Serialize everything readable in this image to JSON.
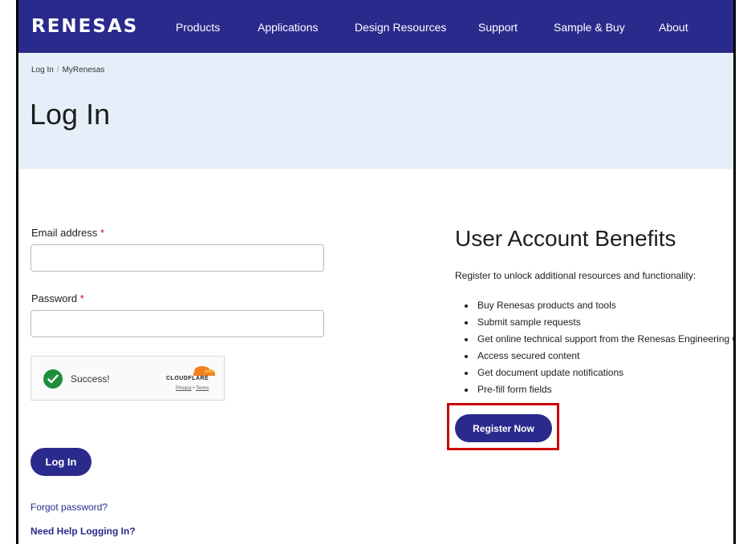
{
  "header": {
    "logo_text": "RENESAS",
    "nav": [
      "Products",
      "Applications",
      "Design Resources",
      "Support",
      "Sample & Buy",
      "About"
    ],
    "background": "#2a2a8c"
  },
  "breadcrumb": {
    "items": [
      "Log In",
      "MyRenesas"
    ],
    "separator": "/"
  },
  "page": {
    "title": "Log In",
    "hero_background": "#e6eff9"
  },
  "form": {
    "email_label": "Email address",
    "password_label": "Password",
    "required_marker": "*",
    "email_value": "",
    "password_value": "",
    "login_button": "Log In",
    "forgot_password": "Forgot password?",
    "need_help": "Need Help Logging In?"
  },
  "captcha": {
    "status_text": "Success!",
    "provider": "CLOUDFLARE",
    "privacy": "Privacy",
    "terms": "Terms",
    "status_icon": "check-circle-icon",
    "status_color": "#1e8e3e"
  },
  "benefits": {
    "title": "User Account Benefits",
    "subtitle": "Register to unlock additional resources and functionality:",
    "items": [
      "Buy Renesas products and tools",
      "Submit sample requests",
      "Get online technical support from the Renesas Engineering Community",
      "Access secured content",
      "Get document update notifications",
      "Pre-fill form fields"
    ],
    "register_button": "Register Now",
    "highlight_color": "#cc0000"
  },
  "colors": {
    "primary": "#2a2a8c",
    "required": "#d0021b"
  }
}
